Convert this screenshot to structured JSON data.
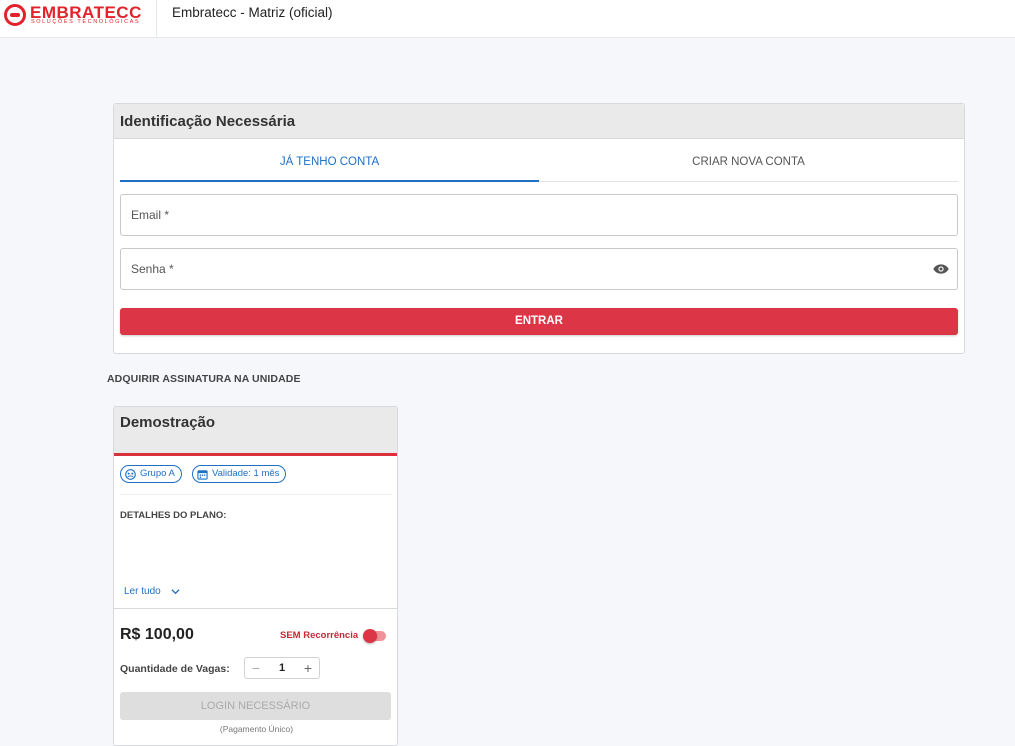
{
  "header": {
    "logo_text": "EMBRATECC",
    "logo_subtitle": "SOLUÇÕES TECNOLÓGICAS",
    "title": "Embratecc - Matriz (oficial)"
  },
  "login": {
    "title": "Identificação Necessária",
    "tabs": [
      {
        "label": "JÁ TENHO CONTA",
        "active": true
      },
      {
        "label": "CRIAR NOVA CONTA",
        "active": false
      }
    ],
    "email_label": "Email *",
    "password_label": "Senha *",
    "submit_label": "ENTRAR"
  },
  "section_label": "ADQUIRIR ASSINATURA NA UNIDADE",
  "plan": {
    "title": "Demostração",
    "chips": [
      {
        "icon": "group-icon",
        "label": "Grupo A"
      },
      {
        "icon": "calendar-icon",
        "label": "Validade: 1 mês"
      }
    ],
    "details_label": "DETALHES DO PLANO:",
    "read_all_label": "Ler tudo",
    "price": "R$ 100,00",
    "recurrence_label": "SEM Recorrência",
    "quantity_label": "Quantidade de Vagas:",
    "quantity_value": "1",
    "buy_button_label": "LOGIN NECESSÁRIO",
    "payment_note": "(Pagamento Único)"
  },
  "colors": {
    "brand_red": "#dc3545",
    "link_blue": "#1f6fc5"
  }
}
